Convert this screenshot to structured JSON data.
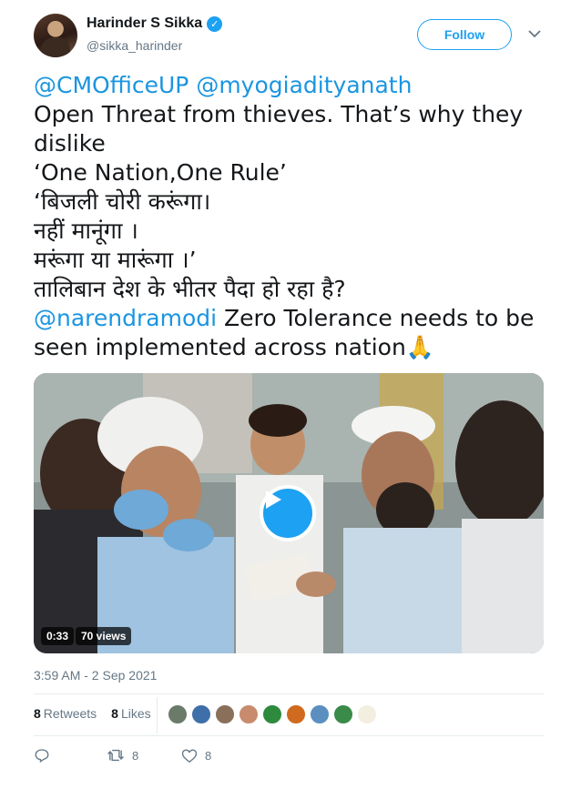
{
  "author": {
    "display_name": "Harinder S Sikka",
    "handle": "@sikka_harinder",
    "verified_icon": "verified-badge-icon"
  },
  "header": {
    "follow_label": "Follow"
  },
  "tweet_text": {
    "mention_1": "@CMOfficeUP",
    "mention_2": "@myogiadityanath",
    "line_1": "Open Threat from thieves. That’s why they",
    "line_2": "dislike",
    "line_3": "‘One Nation,One Rule’",
    "line_4": "‘बिजली चोरी करूंगा।",
    "line_5": "नहीं मानूंगा ।",
    "line_6": "मरूंगा या मारूंगा ।’",
    "line_7": "तालिबान देश के भीतर पैदा हो रहा है?",
    "mention_3": "@narendramodi",
    "line_8": " Zero Tolerance needs to be",
    "line_9": "seen implemented across nation",
    "emoji": "🙏"
  },
  "media": {
    "duration": "0:33",
    "views": "70 views"
  },
  "timestamp": "3:59 AM - 2 Sep 2021",
  "stats": {
    "retweets_count": "8",
    "retweets_label": "Retweets",
    "likes_count": "8",
    "likes_label": "Likes"
  },
  "liker_colors": [
    "#6b7b6a",
    "#3f6fa8",
    "#8a6f5a",
    "#c98b6d",
    "#2e8b3e",
    "#d06a1e",
    "#5a8fc0",
    "#3a8a4a",
    "#f3efe0"
  ],
  "actions": {
    "reply_icon": "reply-icon",
    "retweet_icon": "retweet-icon",
    "retweet_count": "8",
    "like_icon": "heart-icon",
    "like_count": "8"
  },
  "colors": {
    "accent": "#1da1f2",
    "mention": "#1b95e0",
    "muted": "#657786"
  }
}
